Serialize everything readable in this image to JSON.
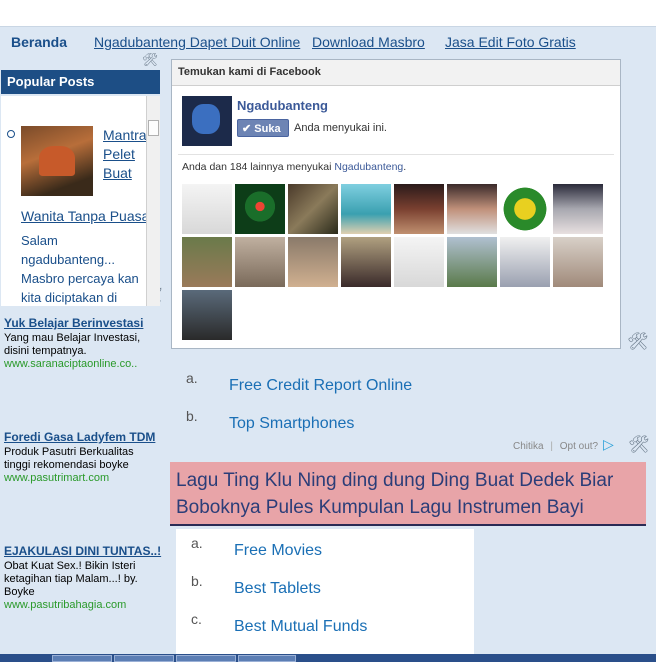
{
  "nav": {
    "items": [
      "Beranda",
      "Ngadubanteng Dapet Duit Online",
      "Download Masbro",
      "Jasa Edit Foto Gratis"
    ]
  },
  "popular_posts": {
    "heading": "Popular Posts",
    "post1_title": "Mantra Pelet Buat",
    "post2_title": "Wanita Tanpa Puasa",
    "snippet": "Salam ngadubanteng... Masbro percaya kan kita diciptakan di"
  },
  "ads": [
    {
      "title": "Yuk Belajar Berinvestasi",
      "text": "Yang mau Belajar Investasi, disini tempatnya.",
      "url": "www.saranaciptaonline.co.."
    },
    {
      "title": "Foredi Gasa Ladyfem TDM",
      "text": "Produk Pasutri Berkualitas tinggi rekomendasi boyke",
      "url": "www.pasutrimart.com"
    },
    {
      "title": "EJAKULASI DINI TUNTAS..!",
      "text": "Obat Kuat Sex.! Bikin Isteri ketagihan tiap Malam...! by. Boyke",
      "url": "www.pasutribahagia.com"
    }
  ],
  "facebook": {
    "header": "Temukan kami di Facebook",
    "page_name": "Ngadubanteng",
    "like_button": "Suka",
    "liked_text": "Anda menyukai ini.",
    "count_text": "Anda dan 184 lainnya menyukai ",
    "count_link": "Ngadubanteng",
    "count_end": "."
  },
  "link_unit_1": {
    "items": [
      {
        "letter": "a.",
        "label": "Free Credit Report Online"
      },
      {
        "letter": "b.",
        "label": "Top Smartphones"
      }
    ],
    "chitika_label": "Chitika",
    "opt_out": "Opt out?"
  },
  "post_title": "Lagu Ting Klu Ning ding dung Ding Buat Dedek Biar Boboknya Pules Kumpulan Lagu Instrumen Bayi",
  "link_unit_2": {
    "items": [
      {
        "letter": "a.",
        "label": "Free Movies"
      },
      {
        "letter": "b.",
        "label": "Best Tablets"
      },
      {
        "letter": "c.",
        "label": "Best Mutual Funds"
      }
    ]
  },
  "colors": {
    "nav_link": "#1a4f8a",
    "popular_header": "#1d4e85",
    "facebook_blue": "#3b5998",
    "link_unit": "#1a6fb5",
    "post_title_bg": "#e8a4a8",
    "ad_url": "#2a9a2a"
  },
  "icons": [
    "wrench-screwdriver-icon",
    "play-triangle-icon"
  ]
}
